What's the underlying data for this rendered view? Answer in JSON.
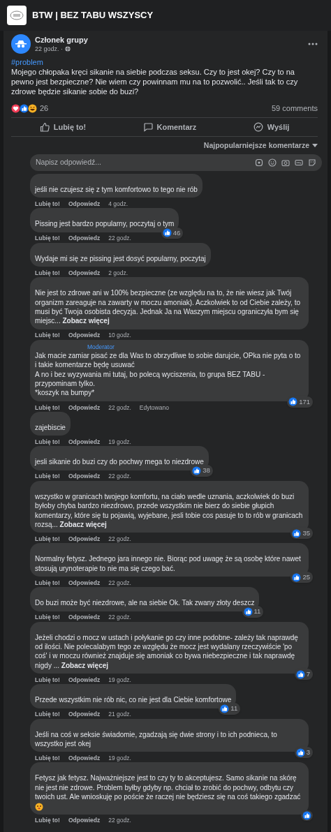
{
  "group": {
    "name": "BTW | BEZ TABU WSZYSCY"
  },
  "post": {
    "author": "Członek grupy",
    "time": "22 godz. ·",
    "hashtag": "#problem",
    "text": "Mojego chłopaka kręci sikanie na siebie podczas seksu. Czy to jest okej? Czy to na pewno jest bezpieczne? Nie wiem czy powinnam mu na to pozwolić.. Jeśli tak to czy zdrowe będzie sikanie sobie do buzi?",
    "reaction_count": "26",
    "comment_count": "59 comments",
    "actions": [
      {
        "kind": "like",
        "label": "Lubię to!"
      },
      {
        "kind": "comment",
        "label": "Komentarz"
      },
      {
        "kind": "send",
        "label": "Wyślij"
      }
    ]
  },
  "sort": {
    "label": "Najpopularniejsze komentarze"
  },
  "reply_field": {
    "placeholder": "Napisz odpowiedź..."
  },
  "comments": [
    {
      "text": "jeśli nie czujesz się z tym komfortowo to tego nie rób",
      "like": "Lubię to!",
      "reply": "Odpowiedz",
      "time": "4 godz."
    },
    {
      "text": "Pissing jest bardzo popularny, poczytaj o tym",
      "like": "Lubię to!",
      "reply": "Odpowiedz",
      "time": "22 godz.",
      "reactions": "46"
    },
    {
      "text": "Wydaje mi się ze pissing jest dosyć popularny, poczytaj",
      "like": "Lubię to!",
      "reply": "Odpowiedz",
      "time": "2 godz."
    },
    {
      "text": "Nie jest to zdrowe ani w 100% bezpieczne (ze względu na to, że nie wiesz jak Twój organizm zareaguje na zawarty w moczu amoniak). Aczkolwiek to od Ciebie zależy, to musi być Twoja osobista decyzja. Jednak Ja na Waszym miejscu ograniczyła bym się miejsc...",
      "see_more": "Zobacz więcej",
      "like": "Lubię to!",
      "reply": "Odpowiedz",
      "time": "10 godz."
    },
    {
      "badge": "Moderator",
      "text": "Jak macie zamiar pisać ze dla Was to obrzydliwe to sobie darujcie, OPka nie pyta o to i takie komentarze będę usuwać\nA no i bez wyzywania mi tutaj, bo polecą wyciszenia, to grupa BEZ TABU - przypominam tylko.\n*koszyk na bumpy*",
      "like": "Lubię to!",
      "reply": "Odpowiedz",
      "time": "22 godz.",
      "edited": "Edytowano",
      "reactions": "171"
    },
    {
      "text": "zajebiscie",
      "like": "Lubię to!",
      "reply": "Odpowiedz",
      "time": "19 godz."
    },
    {
      "text": "jesli sikanie do buzi czy do pochwy mega to niezdrowe",
      "like": "Lubię to!",
      "reply": "Odpowiedz",
      "time": "22 godz.",
      "reactions": "38"
    },
    {
      "text": "wszystko w granicach twojego komfortu, na ciało wedle uznania, aczkolwiek do buzi byłoby chyba bardzo niezdrowo, przede wszystkim nie bierz do siebie głupich komentarzy, które się tu pojawią, wyjebane, jesli tobie cos pasuje to to rób w granicach rozsą...",
      "see_more": "Zobacz więcej",
      "like": "Lubię to!",
      "reply": "Odpowiedz",
      "time": "22 godz.",
      "reactions": "35"
    },
    {
      "text": "Normalny fetysz. Jednego jara innego nie. Biorąc pod uwagę że są osobę które nawet stosują urynoterapie to nie ma się czego bać.",
      "like": "Lubię to!",
      "reply": "Odpowiedz",
      "time": "22 godz.",
      "reactions": "25"
    },
    {
      "text": "Do buzi może być niezdrowe, ale na siebie Ok. Tak zwany złoty deszcz",
      "like": "Lubię to!",
      "reply": "Odpowiedz",
      "time": "22 godz.",
      "reactions": "11"
    },
    {
      "text": "Jeżeli chodzi o mocz w ustach i połykanie go czy inne podobne- zależy tak naprawdę od ilości. Nie polecalabym tego ze względu że mocz jest wydalany rzeczywiście 'po coś' i w moczu również znajduje się amoniak co bywa niebezpieczne i tak naprawdę nigdy ...",
      "see_more": "Zobacz więcej",
      "like": "Lubię to!",
      "reply": "Odpowiedz",
      "time": "19 godz.",
      "reactions": "7"
    },
    {
      "text": "Przede wszystkim nie rób nic, co nie jest dla Ciebie komfortowe",
      "like": "Lubię to!",
      "reply": "Odpowiedz",
      "time": "21 godz.",
      "reactions": "11"
    },
    {
      "text": "Jeśli na coś w seksie świadomie, zgadzają się dwie strony i to ich podnieca, to wszystko jest okej",
      "like": "Lubię to!",
      "reply": "Odpowiedz",
      "time": "19 godz.",
      "reactions": "3"
    },
    {
      "text": "Fetysz jak fetysz. Najważniejsze jest to czy ty to akceptujesz. Samo sikanie na skórę nie jest nie zdrowe. Problem byłby gdyby np. chciał to zrobić do pochwy, odbytu czy twoich ust. Ale wnioskuję po poście że raczej nie będziesz się na coś takiego zgadzać",
      "trailing_emoji": true,
      "like": "Lubię to!",
      "reply": "Odpowiedz",
      "time": "22 godz.",
      "reaction_badge": true
    }
  ]
}
